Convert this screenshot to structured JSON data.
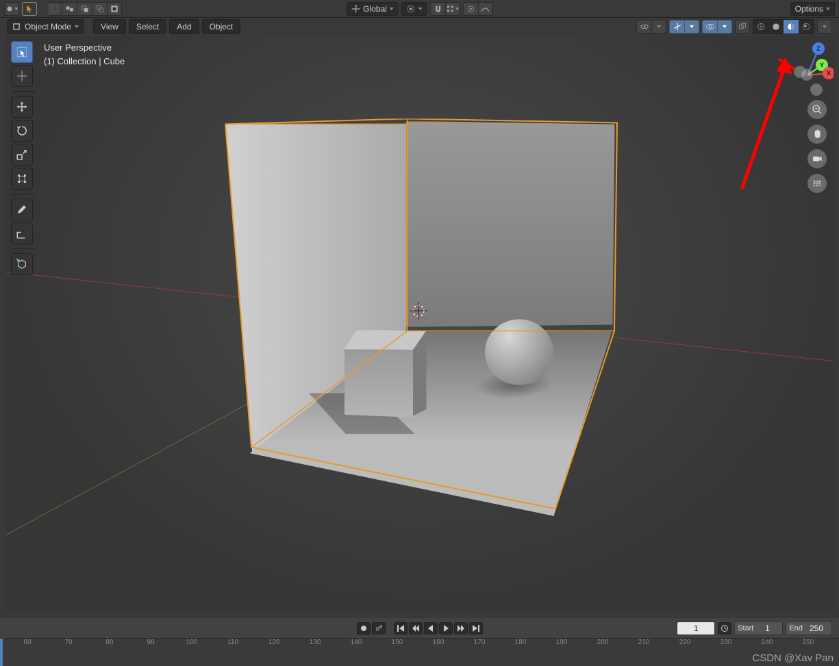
{
  "top_header": {
    "orientation_label": "Global",
    "options_label": "Options"
  },
  "second_header": {
    "mode_label": "Object Mode",
    "menus": [
      "View",
      "Select",
      "Add",
      "Object"
    ]
  },
  "overlay": {
    "line1": "User Perspective",
    "line2": "(1) Collection | Cube"
  },
  "gizmo": {
    "z": "Z",
    "y": "Y",
    "x": "X"
  },
  "timeline": {
    "current_frame": "1",
    "start_label": "Start",
    "start_value": "1",
    "end_label": "End",
    "end_value": "250",
    "ticks": [
      "60",
      "70",
      "80",
      "90",
      "100",
      "110",
      "120",
      "130",
      "140",
      "150",
      "160",
      "170",
      "180",
      "190",
      "200",
      "210",
      "220",
      "230",
      "240",
      "250"
    ]
  },
  "watermark": "CSDN @Xav Pan"
}
